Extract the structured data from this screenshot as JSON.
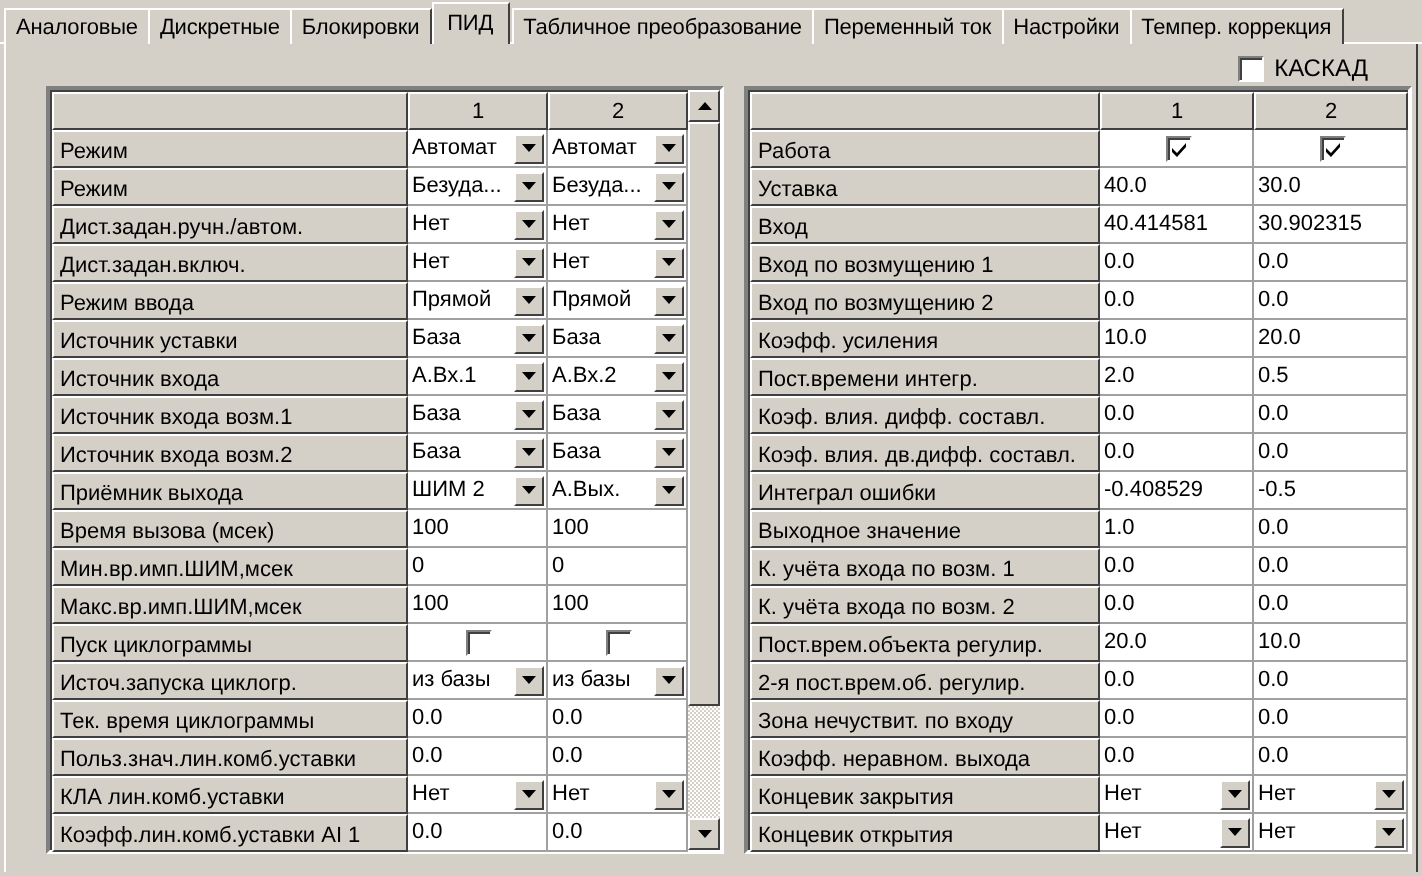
{
  "tabs": [
    {
      "label": "Аналоговые",
      "selected": false
    },
    {
      "label": "Дискретные",
      "selected": false
    },
    {
      "label": "Блокировки",
      "selected": false
    },
    {
      "label": "ПИД",
      "selected": true
    },
    {
      "label": "Табличное преобразование",
      "selected": false
    },
    {
      "label": "Переменный ток",
      "selected": false
    },
    {
      "label": "Настройки",
      "selected": false
    },
    {
      "label": "Темпер. коррекция",
      "selected": false
    }
  ],
  "cascade": {
    "label": "КАСКАД",
    "checked": false
  },
  "left_table": {
    "columns": [
      "1",
      "2"
    ],
    "rows": [
      {
        "label": "Режим",
        "cells": [
          {
            "kind": "select",
            "value": "Автомат"
          },
          {
            "kind": "select",
            "value": "Автомат"
          }
        ]
      },
      {
        "label": "Режим",
        "cells": [
          {
            "kind": "select",
            "value": "Безуда..."
          },
          {
            "kind": "select",
            "value": "Безуда..."
          }
        ]
      },
      {
        "label": "Дист.задан.ручн./автом.",
        "cells": [
          {
            "kind": "select",
            "value": "Нет"
          },
          {
            "kind": "select",
            "value": "Нет"
          }
        ]
      },
      {
        "label": "Дист.задан.включ.",
        "cells": [
          {
            "kind": "select",
            "value": "Нет"
          },
          {
            "kind": "select",
            "value": "Нет"
          }
        ]
      },
      {
        "label": "Режим ввода",
        "cells": [
          {
            "kind": "select",
            "value": "Прямой"
          },
          {
            "kind": "select",
            "value": "Прямой"
          }
        ]
      },
      {
        "label": "Источник уставки",
        "cells": [
          {
            "kind": "select",
            "value": "База"
          },
          {
            "kind": "select",
            "value": "База"
          }
        ]
      },
      {
        "label": "Источник входа",
        "cells": [
          {
            "kind": "select",
            "value": "А.Вх.1"
          },
          {
            "kind": "select",
            "value": "А.Вх.2"
          }
        ]
      },
      {
        "label": "Источник входа возм.1",
        "cells": [
          {
            "kind": "select",
            "value": "База"
          },
          {
            "kind": "select",
            "value": "База"
          }
        ]
      },
      {
        "label": "Источник входа возм.2",
        "cells": [
          {
            "kind": "select",
            "value": "База"
          },
          {
            "kind": "select",
            "value": "База"
          }
        ]
      },
      {
        "label": "Приёмник выхода",
        "cells": [
          {
            "kind": "select",
            "value": "ШИМ 2"
          },
          {
            "kind": "select",
            "value": "А.Вых."
          }
        ]
      },
      {
        "label": "Время вызова (мсек)",
        "cells": [
          {
            "kind": "text",
            "value": "100"
          },
          {
            "kind": "text",
            "value": "100"
          }
        ]
      },
      {
        "label": "Мин.вр.имп.ШИМ,мсек",
        "cells": [
          {
            "kind": "text",
            "value": "0"
          },
          {
            "kind": "text",
            "value": "0"
          }
        ]
      },
      {
        "label": "Макс.вр.имп.ШИМ,мсек",
        "cells": [
          {
            "kind": "text",
            "value": "100"
          },
          {
            "kind": "text",
            "value": "100"
          }
        ]
      },
      {
        "label": "Пуск циклограммы",
        "cells": [
          {
            "kind": "checkbox",
            "checked": false
          },
          {
            "kind": "checkbox",
            "checked": false
          }
        ]
      },
      {
        "label": "Источ.запуска циклогр.",
        "cells": [
          {
            "kind": "select",
            "value": "из базы"
          },
          {
            "kind": "select",
            "value": "из базы"
          }
        ]
      },
      {
        "label": "Тек. время циклограммы",
        "cells": [
          {
            "kind": "text",
            "value": "0.0"
          },
          {
            "kind": "text",
            "value": "0.0"
          }
        ]
      },
      {
        "label": "Польз.знач.лин.комб.уставки",
        "cells": [
          {
            "kind": "text",
            "value": "0.0"
          },
          {
            "kind": "text",
            "value": "0.0"
          }
        ]
      },
      {
        "label": "КЛА лин.комб.уставки",
        "cells": [
          {
            "kind": "select",
            "value": "Нет"
          },
          {
            "kind": "select",
            "value": "Нет"
          }
        ]
      },
      {
        "label": "Коэфф.лин.комб.уставки AI 1",
        "cells": [
          {
            "kind": "text",
            "value": "0.0"
          },
          {
            "kind": "text",
            "value": "0.0"
          }
        ]
      }
    ]
  },
  "right_table": {
    "columns": [
      "1",
      "2"
    ],
    "rows": [
      {
        "label": "Работа",
        "cells": [
          {
            "kind": "checkbox",
            "checked": true
          },
          {
            "kind": "checkbox",
            "checked": true
          }
        ]
      },
      {
        "label": "Уставка",
        "cells": [
          {
            "kind": "text",
            "value": "40.0"
          },
          {
            "kind": "text",
            "value": "30.0"
          }
        ]
      },
      {
        "label": "Вход",
        "cells": [
          {
            "kind": "text",
            "value": "40.414581"
          },
          {
            "kind": "text",
            "value": "30.902315"
          }
        ]
      },
      {
        "label": "Вход по возмущению 1",
        "cells": [
          {
            "kind": "text",
            "value": "0.0"
          },
          {
            "kind": "text",
            "value": "0.0"
          }
        ]
      },
      {
        "label": "Вход по возмущению 2",
        "cells": [
          {
            "kind": "text",
            "value": "0.0"
          },
          {
            "kind": "text",
            "value": "0.0"
          }
        ]
      },
      {
        "label": "Коэфф. усиления",
        "cells": [
          {
            "kind": "text",
            "value": "10.0"
          },
          {
            "kind": "text",
            "value": "20.0"
          }
        ]
      },
      {
        "label": "Пост.времени интегр.",
        "cells": [
          {
            "kind": "text",
            "value": "2.0"
          },
          {
            "kind": "text",
            "value": "0.5"
          }
        ]
      },
      {
        "label": "Коэф. влия. дифф. составл.",
        "cells": [
          {
            "kind": "text",
            "value": "0.0"
          },
          {
            "kind": "text",
            "value": "0.0"
          }
        ]
      },
      {
        "label": "Коэф. влия. дв.дифф. составл.",
        "cells": [
          {
            "kind": "text",
            "value": "0.0"
          },
          {
            "kind": "text",
            "value": "0.0"
          }
        ]
      },
      {
        "label": "Интеграл ошибки",
        "cells": [
          {
            "kind": "text",
            "value": "-0.408529"
          },
          {
            "kind": "text",
            "value": "-0.5"
          }
        ]
      },
      {
        "label": "Выходное значение",
        "cells": [
          {
            "kind": "text",
            "value": "1.0"
          },
          {
            "kind": "text",
            "value": "0.0"
          }
        ]
      },
      {
        "label": "К. учёта входа по возм. 1",
        "cells": [
          {
            "kind": "text",
            "value": "0.0"
          },
          {
            "kind": "text",
            "value": "0.0"
          }
        ]
      },
      {
        "label": "К. учёта входа по возм. 2",
        "cells": [
          {
            "kind": "text",
            "value": "0.0"
          },
          {
            "kind": "text",
            "value": "0.0"
          }
        ]
      },
      {
        "label": "Пост.врем.объекта регулир.",
        "cells": [
          {
            "kind": "text",
            "value": "20.0"
          },
          {
            "kind": "text",
            "value": "10.0"
          }
        ]
      },
      {
        "label": "2-я пост.врем.об. регулир.",
        "cells": [
          {
            "kind": "text",
            "value": "0.0"
          },
          {
            "kind": "text",
            "value": "0.0"
          }
        ]
      },
      {
        "label": "Зона нечуствит. по входу",
        "cells": [
          {
            "kind": "text",
            "value": "0.0"
          },
          {
            "kind": "text",
            "value": "0.0"
          }
        ]
      },
      {
        "label": "Коэфф. неравном. выхода",
        "cells": [
          {
            "kind": "text",
            "value": "0.0"
          },
          {
            "kind": "text",
            "value": "0.0"
          }
        ]
      },
      {
        "label": "Концевик закрытия",
        "cells": [
          {
            "kind": "select",
            "value": "Нет"
          },
          {
            "kind": "select",
            "value": "Нет"
          }
        ]
      },
      {
        "label": "Концевик открытия",
        "cells": [
          {
            "kind": "select",
            "value": "Нет"
          },
          {
            "kind": "select",
            "value": "Нет"
          }
        ]
      }
    ]
  }
}
